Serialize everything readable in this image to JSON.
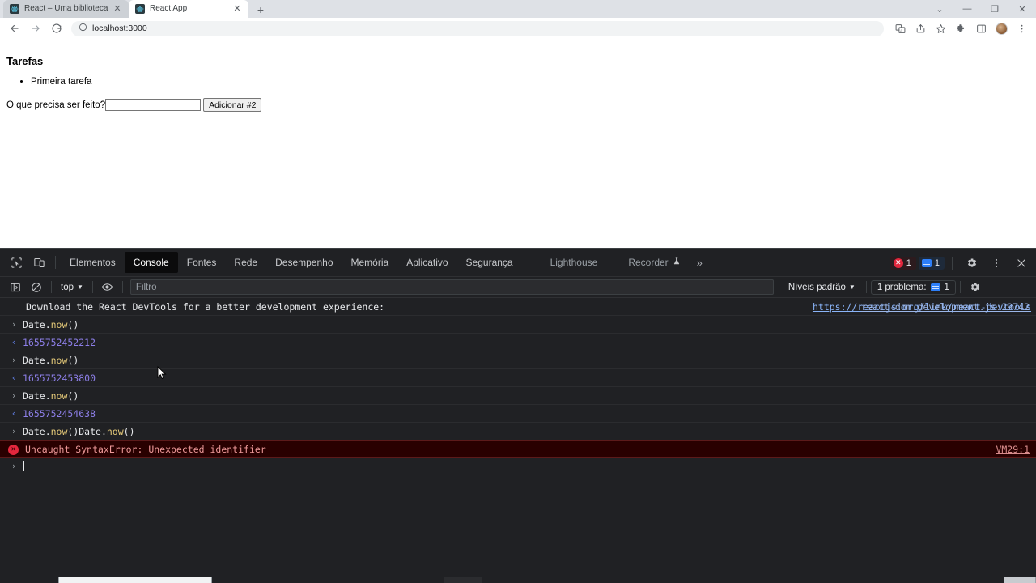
{
  "browser": {
    "tabs": [
      {
        "title": "React – Uma biblioteca JavaScrip",
        "favicon": "react-icon",
        "active": false
      },
      {
        "title": "React App",
        "favicon": "react-icon",
        "active": true
      }
    ],
    "new_tab_label": "+",
    "window_controls": {
      "tab_search": "⌄",
      "minimize": "—",
      "maximize": "❐",
      "close": "✕"
    },
    "toolbar": {
      "back": "←",
      "forward": "→",
      "reload": "⟳",
      "site_info_icon": "info-circle-icon",
      "url": "localhost:3000",
      "translate_icon": "translate-icon",
      "share_icon": "share-icon",
      "bookmark_icon": "star-icon",
      "extensions_icon": "puzzle-icon",
      "side_panel_icon": "side-panel-icon",
      "profile_icon": "avatar-icon",
      "menu_icon": "three-dot-menu-icon"
    }
  },
  "page": {
    "heading": "Tarefas",
    "tasks": [
      "Primeira tarefa"
    ],
    "form": {
      "label": "O que precisa ser feito?",
      "input_value": "",
      "input_placeholder": "",
      "submit_label": "Adicionar #2"
    }
  },
  "devtools": {
    "left_icons": {
      "inspect": "inspect-cursor-icon",
      "device_toggle": "device-toolbar-icon"
    },
    "tabs": [
      {
        "label": "Elementos",
        "selected": false
      },
      {
        "label": "Console",
        "selected": true
      },
      {
        "label": "Fontes",
        "selected": false
      },
      {
        "label": "Rede",
        "selected": false
      },
      {
        "label": "Desempenho",
        "selected": false
      },
      {
        "label": "Memória",
        "selected": false
      },
      {
        "label": "Aplicativo",
        "selected": false
      },
      {
        "label": "Segurança",
        "selected": false
      },
      {
        "label": "Lighthouse",
        "selected": false
      },
      {
        "label": "Recorder",
        "selected": false
      }
    ],
    "recorder_flask_icon": "flask-icon",
    "overflow_label": "»",
    "error_badge_count": "1",
    "message_badge_count": "1",
    "settings_icon": "gear-icon",
    "more_icon": "three-dot-menu-icon",
    "close_icon": "close-icon",
    "filterbar": {
      "sidebar_toggle_icon": "console-sidebar-icon",
      "clear_icon": "clear-console-icon",
      "context": "top",
      "context_caret": "▼",
      "eye_icon": "live-expression-icon",
      "filter_placeholder": "Filtro",
      "filter_value": "",
      "levels_label": "Níveis padrão",
      "levels_caret": "▼",
      "problems_label": "1 problema:",
      "problems_count": "1",
      "settings_icon": "gear-icon"
    },
    "console_rows": [
      {
        "kind": "info",
        "text": "Download the React DevTools for a better development experience: ",
        "link": "https://reactjs.org/link/react-devtools",
        "source": "react-dom.development.js:29742"
      },
      {
        "kind": "input",
        "object": "Date.",
        "prop": "now",
        "args": "()"
      },
      {
        "kind": "output",
        "value": "1655752452212"
      },
      {
        "kind": "input",
        "object": "Date.",
        "prop": "now",
        "args": "()"
      },
      {
        "kind": "output",
        "value": "1655752453800"
      },
      {
        "kind": "input",
        "object": "Date.",
        "prop": "now",
        "args": "()"
      },
      {
        "kind": "output",
        "value": "1655752454638"
      },
      {
        "kind": "input",
        "object": "Date.",
        "prop": "now",
        "args": "()Date.",
        "prop2": "now",
        "args2": "()"
      },
      {
        "kind": "error",
        "text": "Uncaught SyntaxError: Unexpected identifier",
        "source": "VM29:1"
      }
    ],
    "prompt_marker": "›"
  },
  "colors": {
    "devtools_bg": "#202124",
    "error_red": "#e4273d",
    "error_row_bg": "#290000",
    "number_purple": "#8d7fe8",
    "property_yellow": "#e3c878",
    "link_blue": "#8ab4f8",
    "badge_blue": "#2d7ff9"
  }
}
